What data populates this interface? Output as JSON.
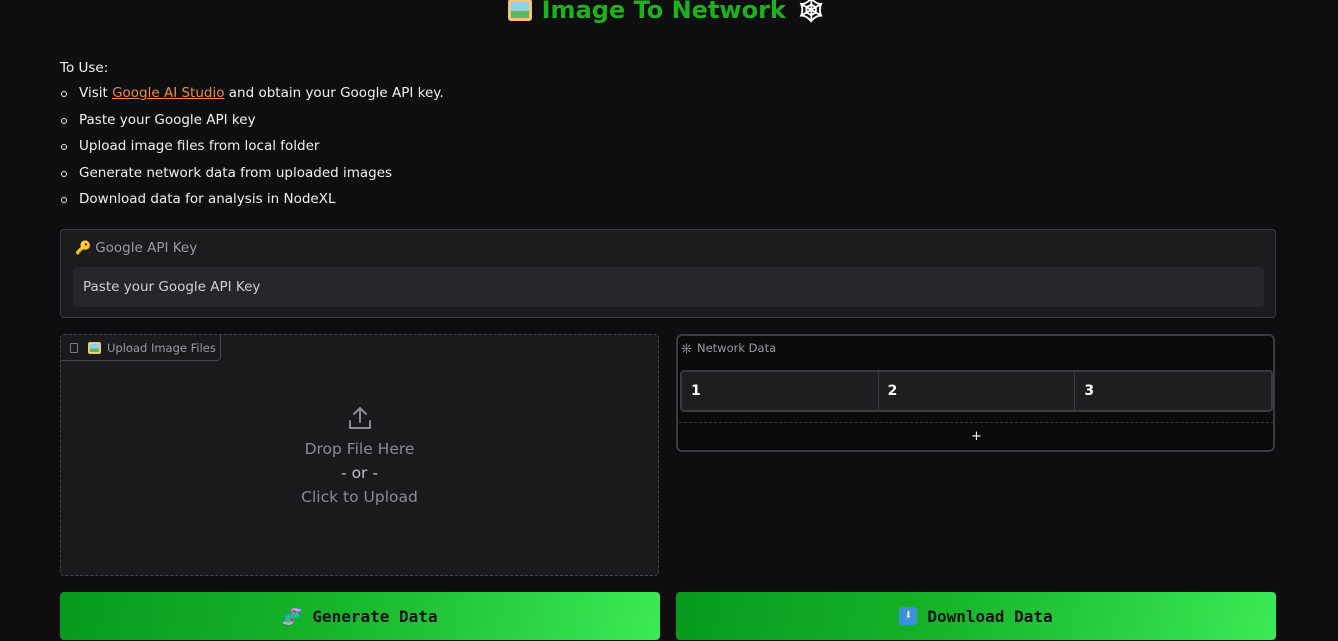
{
  "header": {
    "title": "Image To Network",
    "left_icon": "framed-picture-icon",
    "right_icon": "spider-web-icon"
  },
  "instructions": {
    "heading": "To Use:",
    "steps": [
      {
        "prefix": "Visit ",
        "link": "Google AI Studio",
        "suffix": " and obtain your Google API key."
      },
      {
        "text": "Paste your Google API key"
      },
      {
        "text": "Upload image files from local folder"
      },
      {
        "text": "Generate network data from uploaded images"
      },
      {
        "text": "Download data for analysis in NodeXL"
      }
    ]
  },
  "api_key": {
    "label": "Google API Key",
    "icon": "key-icon",
    "placeholder": "Paste your Google API Key",
    "value": ""
  },
  "upload": {
    "tab_label": "Upload Image Files",
    "drop_text": "Drop File Here",
    "or_text": "- or -",
    "click_text": "Click to Upload"
  },
  "network": {
    "label": "Network Data",
    "columns": [
      "1",
      "2",
      "3"
    ],
    "add_row_label": "+"
  },
  "buttons": {
    "generate": "Generate Data",
    "download": "Download Data"
  },
  "colors": {
    "accent_green": "#1db21d",
    "link_orange": "#f08a3c",
    "background": "#0e0e11"
  }
}
